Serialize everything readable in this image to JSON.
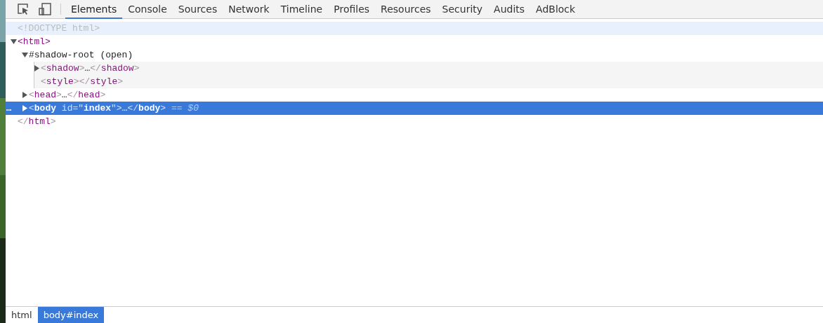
{
  "toolbar": {
    "tools": [
      {
        "kind": "inspect"
      },
      {
        "kind": "device"
      }
    ],
    "tabs": [
      {
        "label": "Elements",
        "selected": true
      },
      {
        "label": "Console",
        "selected": false
      },
      {
        "label": "Sources",
        "selected": false
      },
      {
        "label": "Network",
        "selected": false
      },
      {
        "label": "Timeline",
        "selected": false
      },
      {
        "label": "Profiles",
        "selected": false
      },
      {
        "label": "Resources",
        "selected": false
      },
      {
        "label": "Security",
        "selected": false
      },
      {
        "label": "Audits",
        "selected": false
      },
      {
        "label": "AdBlock",
        "selected": false
      }
    ]
  },
  "dom_tree": [
    {
      "hovered": true,
      "selected": false,
      "tokens": [
        {
          "kind": "doctype",
          "text": "<!DOCTYPE html>"
        }
      ]
    },
    {
      "hovered": false,
      "selected": false,
      "expanded": true,
      "tokens": [
        {
          "kind": "tag",
          "text": "<html>"
        }
      ],
      "children": [
        {
          "shadow_root": true,
          "hovered": false,
          "selected": false,
          "expanded": true,
          "tokens": [
            {
              "kind": "text",
              "text": "#shadow-root (open)"
            }
          ],
          "children": [
            {
              "hovered": false,
              "selected": false,
              "expanded": false,
              "tokens": [
                {
                  "kind": "bracket",
                  "text": "<"
                },
                {
                  "kind": "tag",
                  "text": "shadow"
                },
                {
                  "kind": "bracket",
                  "text": ">"
                },
                {
                  "kind": "text",
                  "text": "…"
                },
                {
                  "kind": "bracket",
                  "text": "</"
                },
                {
                  "kind": "tag",
                  "text": "shadow"
                },
                {
                  "kind": "bracket",
                  "text": ">"
                }
              ]
            },
            {
              "hovered": false,
              "selected": false,
              "tokens": [
                {
                  "kind": "bracket",
                  "text": "<"
                },
                {
                  "kind": "tag",
                  "text": "style"
                },
                {
                  "kind": "bracket",
                  "text": "></"
                },
                {
                  "kind": "tag",
                  "text": "style"
                },
                {
                  "kind": "bracket",
                  "text": ">"
                }
              ]
            }
          ]
        },
        {
          "hovered": false,
          "selected": false,
          "expanded": false,
          "tokens": [
            {
              "kind": "bracket",
              "text": "<"
            },
            {
              "kind": "tag",
              "text": "head"
            },
            {
              "kind": "bracket",
              "text": ">"
            },
            {
              "kind": "text",
              "text": "…"
            },
            {
              "kind": "bracket",
              "text": "</"
            },
            {
              "kind": "tag",
              "text": "head"
            },
            {
              "kind": "bracket",
              "text": ">"
            }
          ]
        },
        {
          "hovered": false,
          "selected": true,
          "expanded": false,
          "tokens": [
            {
              "kind": "bracket",
              "text": "<"
            },
            {
              "kind": "tag",
              "text": "body"
            },
            {
              "kind": "attr",
              "text": " id"
            },
            {
              "kind": "bracket",
              "text": "=\""
            },
            {
              "kind": "value",
              "text": "index"
            },
            {
              "kind": "bracket",
              "text": "\">"
            },
            {
              "kind": "text",
              "text": "…"
            },
            {
              "kind": "bracket",
              "text": "</"
            },
            {
              "kind": "tag",
              "text": "body"
            },
            {
              "kind": "bracket",
              "text": ">"
            },
            {
              "kind": "marker",
              "text": " == $0"
            }
          ]
        }
      ]
    },
    {
      "hovered": false,
      "selected": false,
      "tokens": [
        {
          "kind": "bracket",
          "text": "</"
        },
        {
          "kind": "tag",
          "text": "html"
        },
        {
          "kind": "bracket",
          "text": ">"
        }
      ]
    }
  ],
  "row_menu": "…",
  "breadcrumbs": [
    {
      "label": "html",
      "selected": false
    },
    {
      "label": "body#index",
      "selected": true
    }
  ]
}
